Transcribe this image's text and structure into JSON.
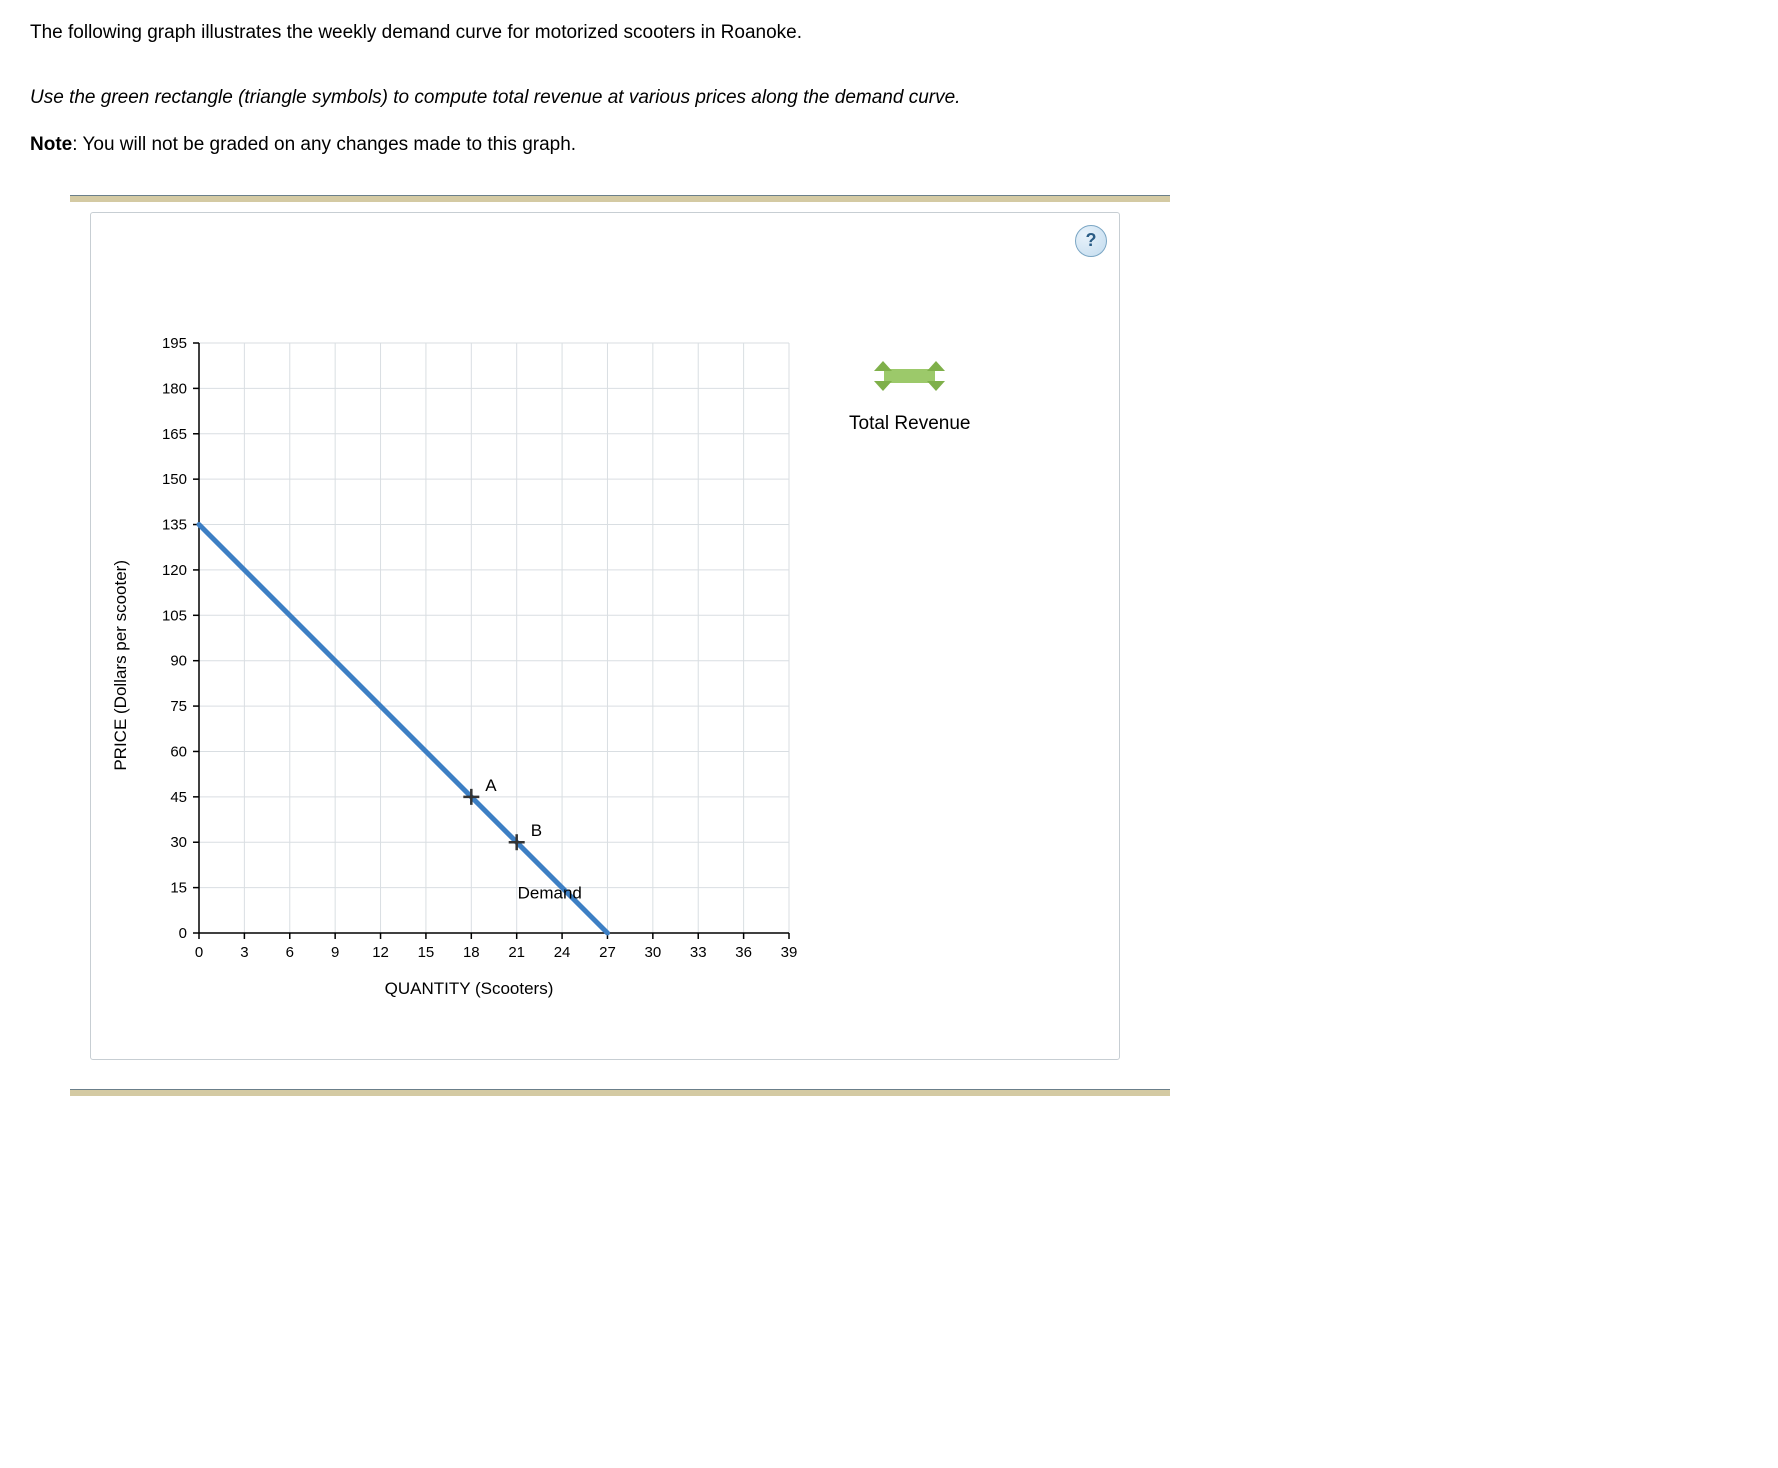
{
  "intro": "The following graph illustrates the weekly demand curve for motorized scooters in Roanoke.",
  "instruction": "Use the green rectangle (triangle symbols) to compute total revenue at various prices along the demand curve.",
  "note_label": "Note",
  "note_text": ": You will not be graded on any changes made to this graph.",
  "help_symbol": "?",
  "legend": {
    "label": "Total Revenue"
  },
  "chart_data": {
    "type": "line",
    "title": "",
    "xlabel": "QUANTITY (Scooters)",
    "ylabel": "PRICE (Dollars per scooter)",
    "xlim": [
      0,
      39
    ],
    "ylim": [
      0,
      195
    ],
    "x_ticks": [
      0,
      3,
      6,
      9,
      12,
      15,
      18,
      21,
      24,
      27,
      30,
      33,
      36,
      39
    ],
    "y_ticks": [
      0,
      15,
      30,
      45,
      60,
      75,
      90,
      105,
      120,
      135,
      150,
      165,
      180,
      195
    ],
    "series": [
      {
        "name": "Demand",
        "x": [
          0,
          27
        ],
        "values": [
          135,
          0
        ]
      }
    ],
    "markers": [
      {
        "name": "A",
        "x": 18,
        "y": 45
      },
      {
        "name": "B",
        "x": 21,
        "y": 30
      }
    ]
  }
}
